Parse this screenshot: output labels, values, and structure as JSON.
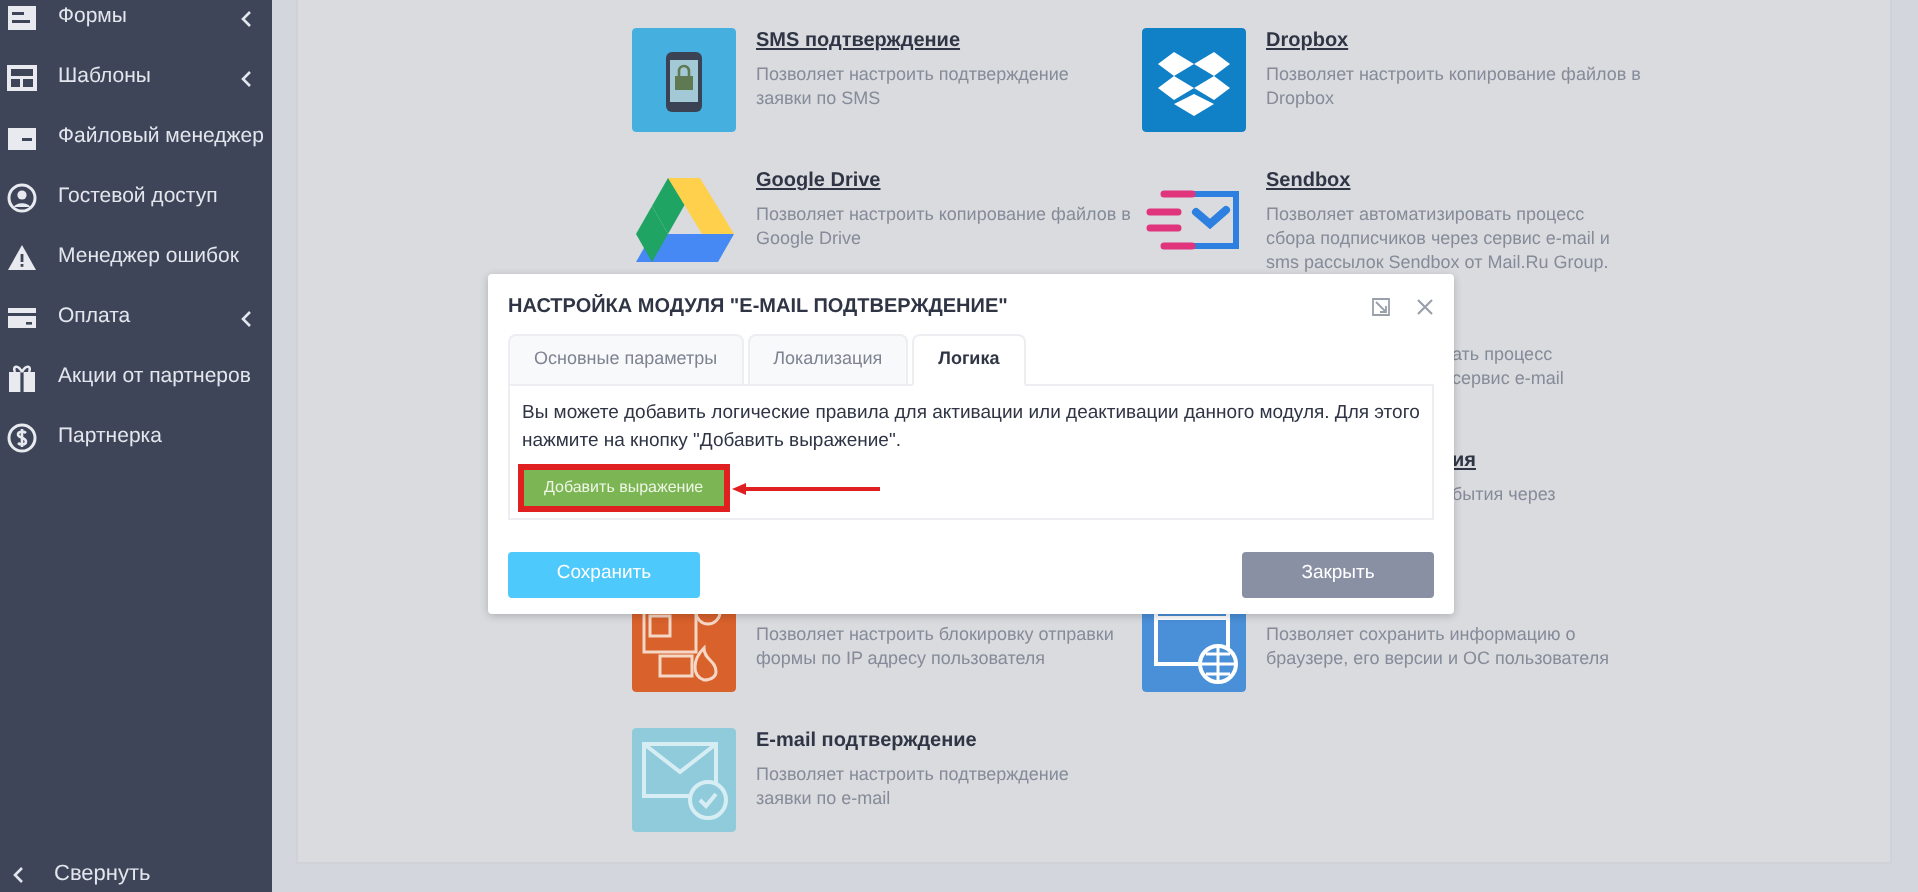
{
  "sidebar": {
    "items": [
      {
        "label": "Формы",
        "expandable": true
      },
      {
        "label": "Шаблоны",
        "expandable": true
      },
      {
        "label": "Файловый менеджер"
      },
      {
        "label": "Гостевой доступ"
      },
      {
        "label": "Менеджер ошибок"
      },
      {
        "label": "Оплата",
        "expandable": true
      },
      {
        "label": "Акции от партнеров"
      },
      {
        "label": "Партнерка"
      }
    ],
    "collapse": {
      "label": "Свернуть"
    }
  },
  "modules": [
    {
      "kind": "module",
      "title": "SMS подтверждение",
      "linked": true,
      "lines": [
        "Позволяет настроить подтверждение",
        "заявки по SMS"
      ]
    },
    {
      "kind": "module",
      "title": "Dropbox",
      "linked": true,
      "lines": [
        "Позволяет настроить копирование файлов в",
        "Dropbox"
      ]
    },
    {
      "kind": "module",
      "title": "Google Drive",
      "linked": true,
      "lines": [
        "Позволяет настроить копирование файлов в",
        "Google Drive"
      ]
    },
    {
      "kind": "module",
      "title": "Sendbox",
      "linked": true,
      "lines": [
        "Позволяет автоматизировать процесс",
        "сбора подписчиков через сервис e-mail и",
        "sms рассылок Sendbox от Mail.Ru Group."
      ]
    },
    {
      "kind": "covered"
    },
    {
      "kind": "covered",
      "lines": [
        "ать процесс",
        "сервис e-mail"
      ]
    },
    {
      "kind": "covered"
    },
    {
      "kind": "covered",
      "title": "ия",
      "linked": true,
      "lines": [
        "бытия через"
      ]
    },
    {
      "kind": "module",
      "lines": [
        "Позволяет настроить блокировку отправки",
        "формы по IP адресу пользователя"
      ]
    },
    {
      "kind": "module",
      "lines": [
        "Позволяет сохранить информацию о",
        "браузере, его версии и ОС пользователя"
      ]
    },
    {
      "kind": "module",
      "title": "E-mail подтверждение",
      "linked": false,
      "lines": [
        "Позволяет настроить подтверждение",
        "заявки по e-mail"
      ]
    }
  ],
  "modal": {
    "title": "НАСТРОЙКА МОДУЛЯ \"E-MAIL ПОДТВЕРЖДЕНИЕ\"",
    "tabs": [
      {
        "label": "Основные параметры",
        "selected": false
      },
      {
        "label": "Локализация",
        "selected": false
      },
      {
        "label": "Логика",
        "selected": true
      }
    ],
    "text": "Вы можете добавить логические правила для активации или деактивации данного модуля. Для этого нажмите на кнопку \"Добавить выражение\".",
    "add_button": {
      "label": "Добавить выражение",
      "highlighted": true
    },
    "buttons": [
      {
        "kind": "primary",
        "label": "Сохранить"
      },
      {
        "kind": "secondary",
        "label": "Закрыть"
      }
    ]
  }
}
